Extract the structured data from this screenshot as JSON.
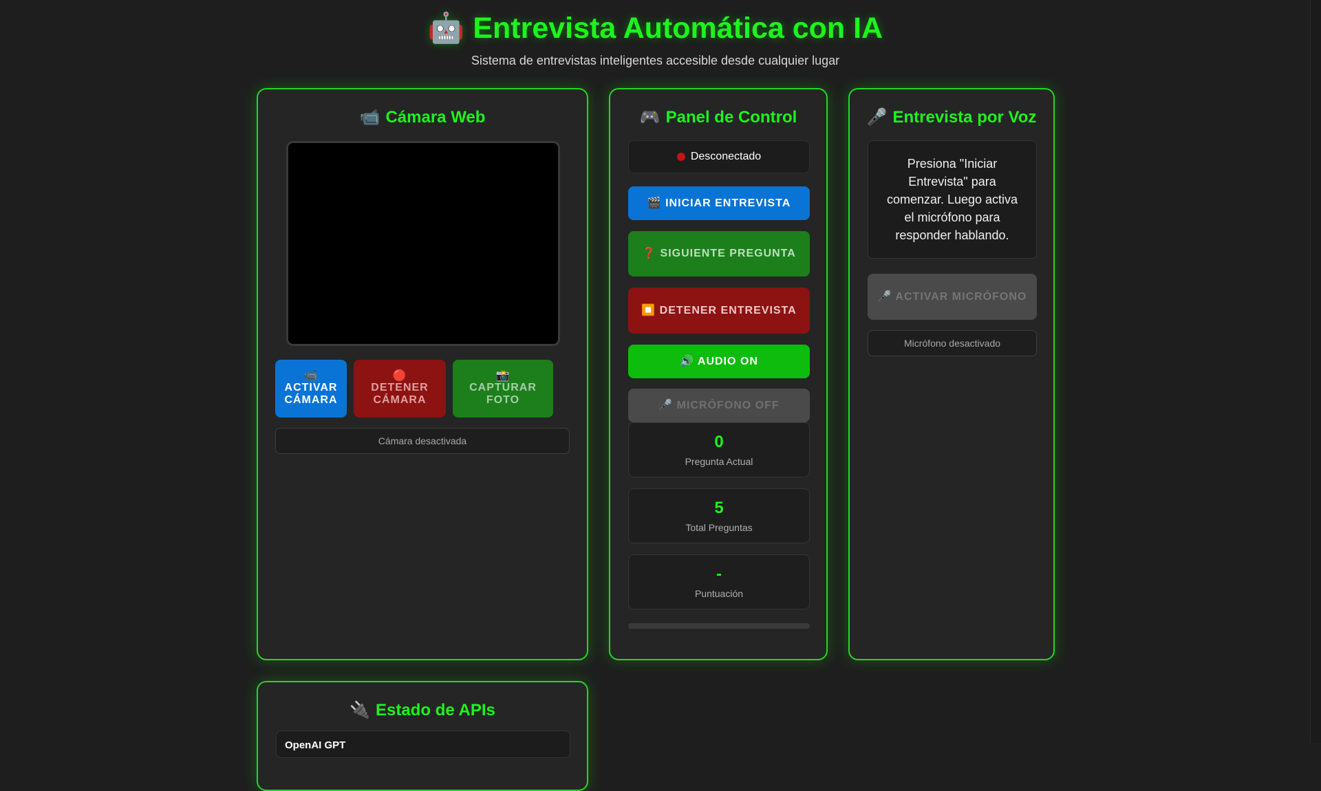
{
  "header": {
    "title": "🤖 Entrevista Automática con IA",
    "subtitle": "Sistema de entrevistas inteligentes accesible desde cualquier lugar"
  },
  "camera": {
    "icon": "📹",
    "title": "Cámara Web",
    "buttons": [
      {
        "icon": "📹",
        "label": "ACTIVAR CÁMARA"
      },
      {
        "icon": "🔴",
        "label": "DETENER CÁMARA"
      },
      {
        "icon": "📸",
        "label": "CAPTURAR FOTO"
      }
    ],
    "status": "Cámara desactivada"
  },
  "control": {
    "icon": "🎮",
    "title": "Panel de Control",
    "connection": "Desconectado",
    "buttons": {
      "start": "🎬 INICIAR ENTREVISTA",
      "next": "❓ SIGUIENTE PREGUNTA",
      "stop": "⏹️ DETENER ENTREVISTA",
      "audio": "🔊 AUDIO ON",
      "mic": "🎤 MICRÓFONO OFF"
    },
    "stats": [
      {
        "value": "0",
        "label": "Pregunta Actual"
      },
      {
        "value": "5",
        "label": "Total Preguntas"
      },
      {
        "value": "-",
        "label": "Puntuación"
      }
    ],
    "progress": 0
  },
  "voice": {
    "icon": "🎤",
    "title": "Entrevista por Voz",
    "prompt": "Presiona \"Iniciar Entrevista\" para comenzar. Luego activa el micrófono para responder hablando.",
    "activate": "🎤 ACTIVAR MICRÓFONO",
    "status": "Micrófono desactivado"
  },
  "apis": {
    "icon": "🔌",
    "title": "Estado de APIs",
    "first_item": "OpenAI GPT"
  },
  "colors": {
    "accent": "#1df41d",
    "blue": "#0a74d6",
    "red": "#8d1212",
    "green": "#1c7f1c",
    "bright_green": "#0dbc0d",
    "disabled": "#4a4a4a"
  }
}
